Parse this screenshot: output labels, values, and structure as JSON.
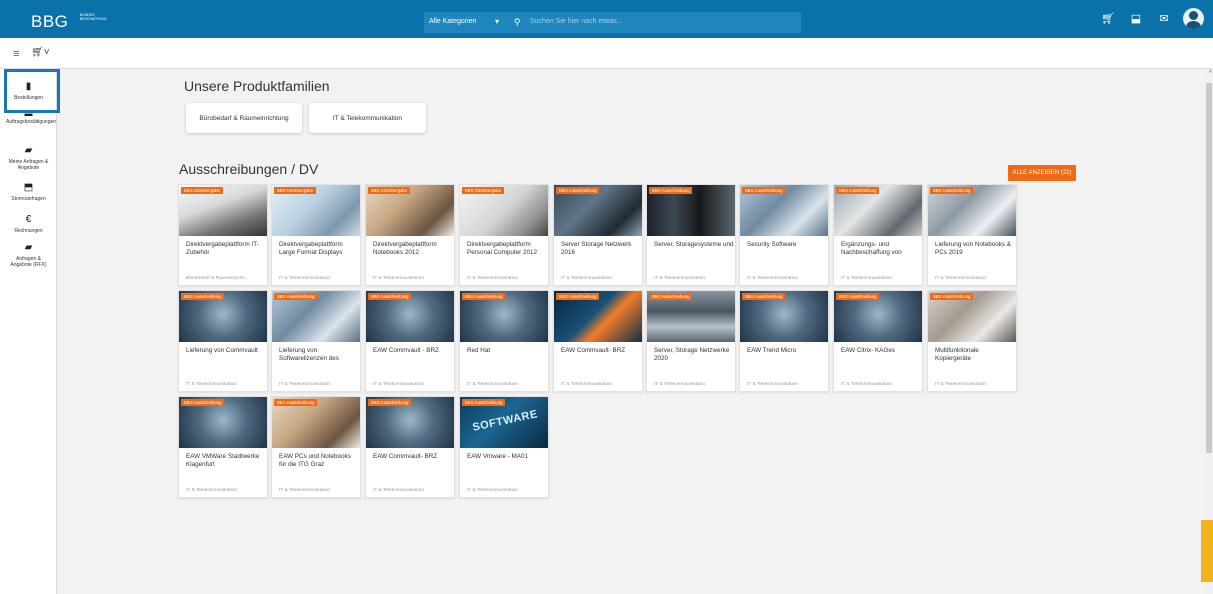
{
  "header": {
    "logo": "BBG",
    "logo_sub": "BUNDES BESCHAFFUNG",
    "category_select": "Alle Kategorien",
    "search_placeholder": "Suchen Sie hier nach etwas..."
  },
  "sidebar": {
    "items": [
      {
        "label": "Bestellungen",
        "icon": "clipboard-icon"
      },
      {
        "label": "Auftragsbestätigungen",
        "icon": "check-document-icon"
      },
      {
        "label": "Meine Anfragen & Angebote",
        "icon": "chat-icon"
      },
      {
        "label": "Stornoanfragen",
        "icon": "storno-icon"
      },
      {
        "label": "Rechnungen",
        "icon": "euro-icon"
      },
      {
        "label": "Anfragen & Angebote (RFX)",
        "icon": "rfx-icon"
      }
    ]
  },
  "families": {
    "title": "Unsere Produktfamilien",
    "items": [
      "Bürobedarf & Raumeinrichtung",
      "IT & Telekommunikation"
    ]
  },
  "tenders": {
    "title": "Ausschreibungen / DV",
    "show_all": "ALLE ANZEIGEN (22)",
    "cards": [
      {
        "badge": "BBG Direktvergabe",
        "title": "Direktvergabeplattform IT-Zubehör",
        "category": "Bürobedarf & Raumeinricht..."
      },
      {
        "badge": "BBG Direktvergabe",
        "title": "Direktvergabeplattform Large Format Displays",
        "category": "IT & Telekommunikation"
      },
      {
        "badge": "BBG Direktvergabe",
        "title": "Direktvergabeplattform Notebooks 2012",
        "category": "IT & Telekommunikation"
      },
      {
        "badge": "BBG Direktvergabe",
        "title": "Direktvergabeplattform Personal Computer 2012",
        "category": "IT & Telekommunikation"
      },
      {
        "badge": "BBG Ausschreibung",
        "title": "Server Storage Netzwerk 2016",
        "category": "IT & Telekommunikation"
      },
      {
        "badge": "BBG Ausschreibung",
        "title": "Server, Storagesysteme und",
        "category": "IT & Telekommunikation"
      },
      {
        "badge": "BBG Ausschreibung",
        "title": "Security Software",
        "category": "IT & Telekommunikation"
      },
      {
        "badge": "BBG Ausschreibung",
        "title": "Ergänzungs- und Nachbeschaffung von",
        "category": "IT & Telekommunikation"
      },
      {
        "badge": "BBG Ausschreibung",
        "title": "Lieferung von Notebooks & PCs 2019",
        "category": "IT & Telekommunikation"
      },
      {
        "badge": "BBG Ausschreibung",
        "title": "Lieferung von Commvault",
        "category": "IT & Telekommunikation"
      },
      {
        "badge": "BBG Ausschreibung",
        "title": "Lieferung von Softwarelizenzen des",
        "category": "IT & Telekommunikation"
      },
      {
        "badge": "BBG Ausschreibung",
        "title": "EAW Commvault - BRZ",
        "category": "IT & Telekommunikation"
      },
      {
        "badge": "BBG Ausschreibung",
        "title": "Red Hat",
        "category": "IT & Telekommunikation"
      },
      {
        "badge": "BBG Ausschreibung",
        "title": "EAW Commvault- BRZ",
        "category": "IT & Telekommunikation"
      },
      {
        "badge": "BBG Ausschreibung",
        "title": "Server, Storage Netzwerke 2020",
        "category": "IT & Telekommunikation"
      },
      {
        "badge": "BBG Ausschreibung",
        "title": "EAW Trend Micro",
        "category": "IT & Telekommunikation"
      },
      {
        "badge": "BBG Ausschreibung",
        "title": "EAW Citrix- KAGes",
        "category": "IT & Telekommunikation"
      },
      {
        "badge": "BBG Ausschreibung",
        "title": "Multifunktionale Kopiergeräte",
        "category": "IT & Telekommunikation"
      },
      {
        "badge": "BBG Ausschreibung",
        "title": "EAW VMWare Stadtwerke Klagenfurt",
        "category": "IT & Telekommunikation"
      },
      {
        "badge": "BBG Ausschreibung",
        "title": "EAW PCs und Notebooks für die ITG Graz",
        "category": "IT & Telekommunikation"
      },
      {
        "badge": "BBG Ausschreibung",
        "title": "EAW Commvault- BRZ",
        "category": "IT & Telekommunikation"
      },
      {
        "badge": "BBG Ausschreibung",
        "title": "EAW Vmware - MA01",
        "category": "IT & Telekommunikation",
        "image_text": "SOFTWARE"
      }
    ]
  }
}
